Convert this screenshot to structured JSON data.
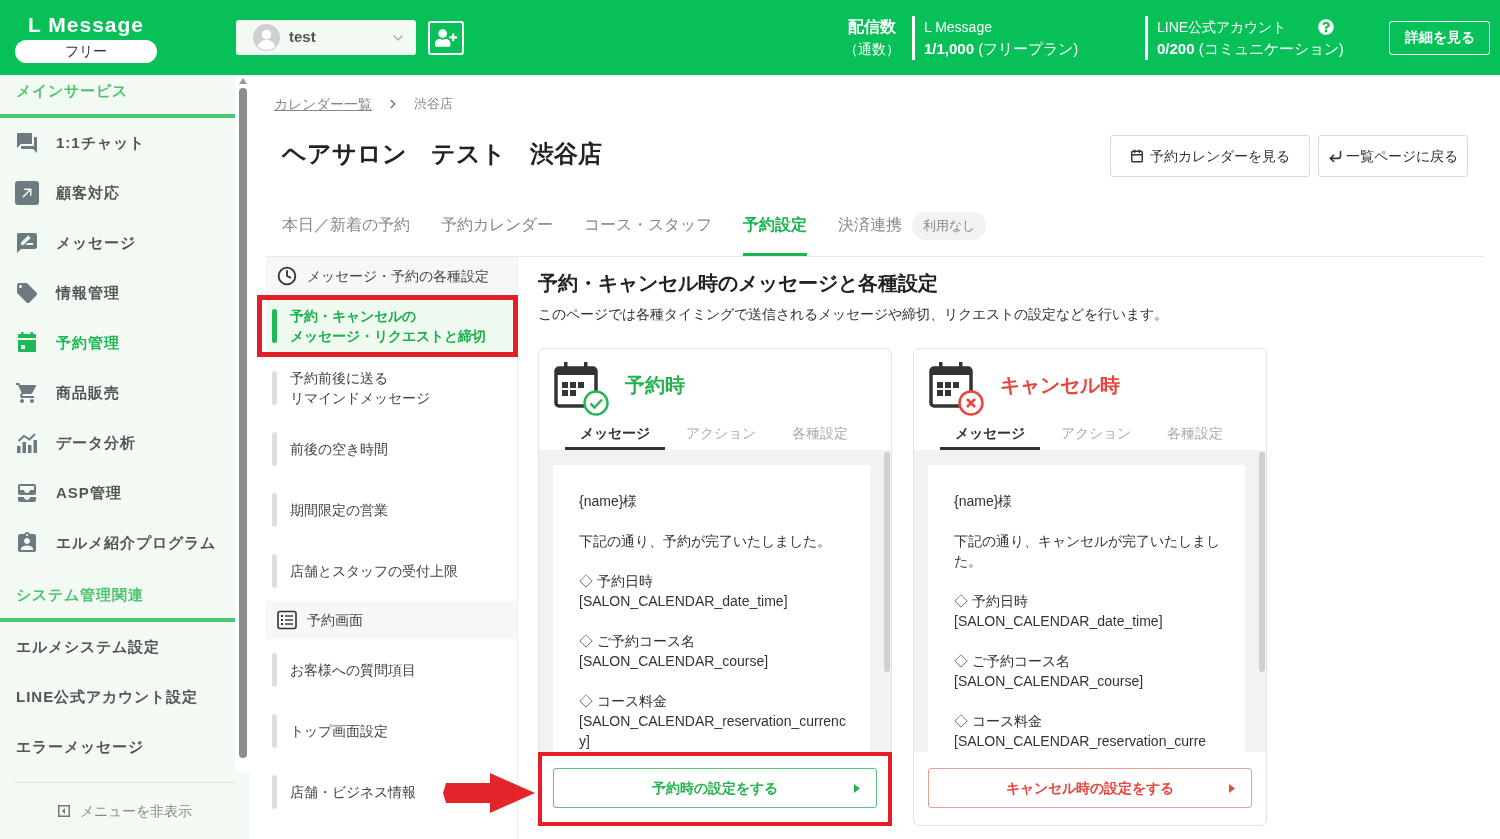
{
  "header": {
    "logo": "L Message",
    "plan_badge": "フリー",
    "account": {
      "name": "test"
    },
    "delivery": {
      "label": "配信数",
      "unit": "（通数）"
    },
    "counters": [
      {
        "title": "L Message",
        "value": "**1/1,000** (フリープラン)",
        "help": false
      },
      {
        "title": "LINE公式アカウント",
        "value": "**0/200** (コミュニケーション)",
        "help": true
      }
    ],
    "details_button": "詳細を見る"
  },
  "sidebar": {
    "sections": [
      {
        "title": "メインサービス",
        "items": [
          {
            "label": "1:1チャット",
            "selected": false
          },
          {
            "label": "顧客対応",
            "selected": false
          },
          {
            "label": "メッセージ",
            "selected": false
          },
          {
            "label": "情報管理",
            "selected": false
          },
          {
            "label": "予約管理",
            "selected": true
          },
          {
            "label": "商品販売",
            "selected": false
          },
          {
            "label": "データ分析",
            "selected": false
          },
          {
            "label": "ASP管理",
            "selected": false
          },
          {
            "label": "エルメ紹介プログラム",
            "selected": false
          }
        ]
      },
      {
        "title": "システム管理関連",
        "items": [
          {
            "label": "エルメシステム設定",
            "selected": false
          },
          {
            "label": "LINE公式アカウント設定",
            "selected": false
          },
          {
            "label": "エラーメッセージ",
            "selected": false
          }
        ]
      }
    ],
    "hide_menu": "メニューを非表示"
  },
  "breadcrumb": [
    {
      "label": "カレンダー一覧",
      "link": true
    },
    {
      "label": "渋谷店",
      "link": false
    }
  ],
  "page": {
    "title": "ヘアサロン　テスト　渋谷店",
    "actions": [
      "予約カレンダーを見る",
      "一覧ページに戻る"
    ]
  },
  "tabs": [
    {
      "label": "本日／新着の予約",
      "selected": false
    },
    {
      "label": "予約カレンダー",
      "selected": false
    },
    {
      "label": "コース・スタッフ",
      "selected": false
    },
    {
      "label": "予約設定",
      "selected": true
    },
    {
      "label": "決済連携",
      "selected": false,
      "badge": "利用なし"
    }
  ],
  "subnav": [
    {
      "kind": "group",
      "label": "メッセージ・予約の各種設定"
    },
    {
      "kind": "item",
      "label": [
        "予約・キャンセルの",
        "メッセージ・リクエストと締切"
      ],
      "selected": true,
      "highlighted": true
    },
    {
      "kind": "item",
      "label": [
        "予約前後に送る",
        "リマインドメッセージ"
      ],
      "selected": false,
      "highlighted": false
    },
    {
      "kind": "item",
      "label": "前後の空き時間",
      "selected": false,
      "highlighted": false
    },
    {
      "kind": "item",
      "label": "期間限定の営業",
      "selected": false,
      "highlighted": false
    },
    {
      "kind": "item",
      "label": "店舗とスタッフの受付上限",
      "selected": false,
      "highlighted": false
    },
    {
      "kind": "group",
      "label": "予約画面"
    },
    {
      "kind": "item",
      "label": "お客様への質問項目",
      "selected": false,
      "highlighted": false
    },
    {
      "kind": "item",
      "label": "トップ画面設定",
      "selected": false,
      "highlighted": false
    },
    {
      "kind": "item",
      "label": "店舗・ビジネス情報",
      "selected": false,
      "highlighted": false
    }
  ],
  "content": {
    "heading": "予約・キャンセル時のメッセージと各種設定",
    "description": "このページでは各種タイミングで送信されるメッセージや締切、リクエストの設定などを行います。",
    "cards": [
      {
        "kind": "reservation",
        "title": "予約時",
        "tabs": [
          {
            "label": "メッセージ",
            "selected": true
          },
          {
            "label": "アクション",
            "selected": false
          },
          {
            "label": "各種設定",
            "selected": false
          }
        ],
        "message": [
          "{name}様",
          "下記の通り、予約が完了いたしました。",
          "◇ 予約日時\n[SALON_CALENDAR_date_time]",
          "◇ ご予約コース名\n[SALON_CALENDAR_course]",
          "◇ コース料金\n[SALON_CALENDAR_reservation_currency]"
        ],
        "button": "予約時の設定をする",
        "highlighted": true
      },
      {
        "kind": "cancel",
        "title": "キャンセル時",
        "tabs": [
          {
            "label": "メッセージ",
            "selected": true
          },
          {
            "label": "アクション",
            "selected": false
          },
          {
            "label": "各種設定",
            "selected": false
          }
        ],
        "message": [
          "{name}様",
          "下記の通り、キャンセルが完了いたしました。",
          "◇ 予約日時\n[SALON_CALENDAR_date_time]",
          "◇ ご予約コース名\n[SALON_CALENDAR_course]",
          "◇ コース料金\n[SALON_CALENDAR_reservation_curre"
        ],
        "button": "キャンセル時の設定をする",
        "highlighted": false
      }
    ]
  }
}
